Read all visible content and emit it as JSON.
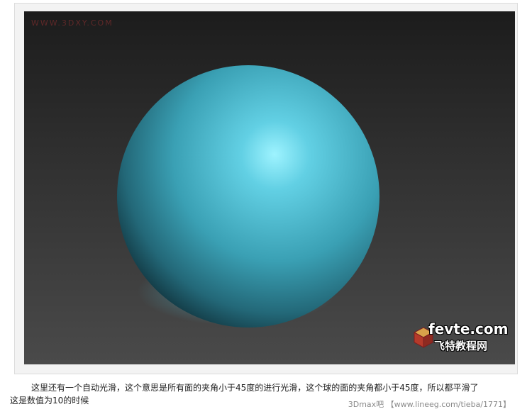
{
  "viewport": {
    "watermark": "WWW.3DXY.COM",
    "background_top": "#1c1c1c",
    "background_bottom": "#4a4a4a"
  },
  "sphere": {
    "color": "#3fa3b5",
    "highlight_color": "#9ef3ff",
    "shadow_color": "#0f2f38"
  },
  "logo": {
    "top_text": "fevte.com",
    "bottom_text": "飞特教程网"
  },
  "caption": {
    "line1": "这里还有一个自动光滑，这个意思是所有面的夹角小于45度的进行光滑，这个球的面的夹角都小于45度，所以都平滑了",
    "line2": "这是数值为10的时候"
  },
  "source_watermark": "3Dmax吧 【www.lineeg.com/tieba/1771】"
}
